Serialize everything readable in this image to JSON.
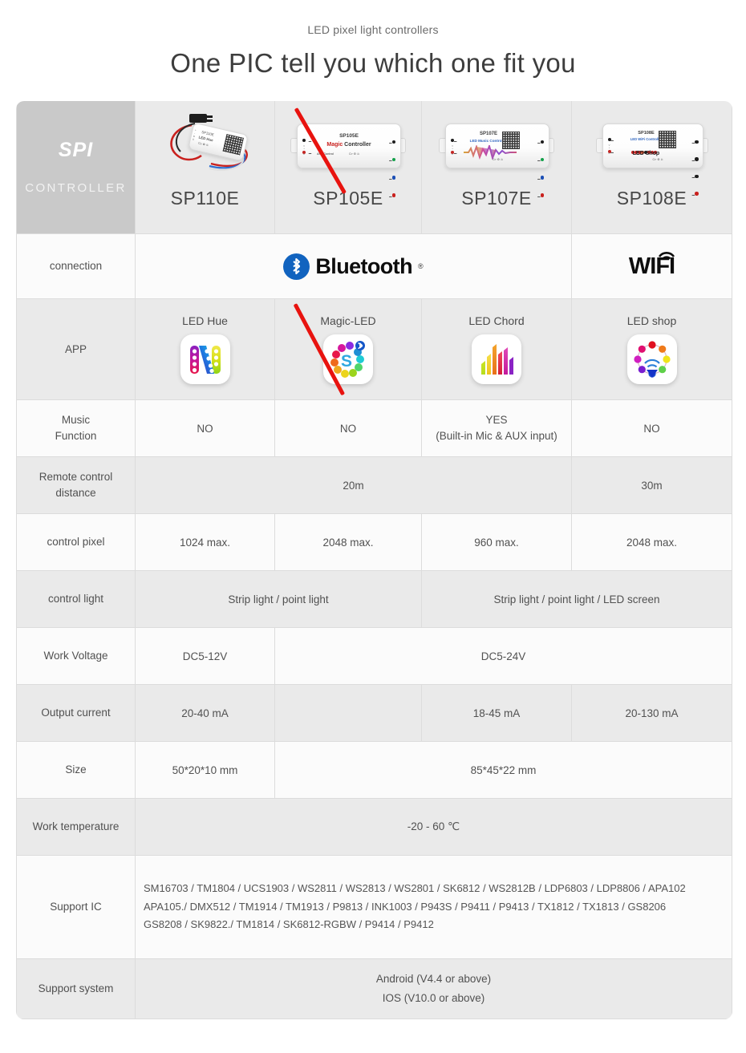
{
  "header": {
    "kicker": "LED pixel light controllers",
    "headline": "One PIC tell you which one fit you"
  },
  "table": {
    "corner": {
      "title": "SPI",
      "subtitle": "CONTROLLER"
    },
    "products": [
      {
        "name": "SP110E",
        "device_label_top": "SP110E",
        "device_label_sub": "LED Hue",
        "struck": false
      },
      {
        "name": "SP105E",
        "device_label_top": "SP105E",
        "device_label_sub": "Magic Controller",
        "device_label_small": "APP Control",
        "struck": true
      },
      {
        "name": "SP107E",
        "device_label_top": "SP107E",
        "device_label_sub": "LED Music Controller",
        "struck": false
      },
      {
        "name": "SP108E",
        "device_label_top": "SP108E",
        "device_label_sub": "LED WiFi Controller",
        "device_label_small": "LED Shop",
        "struck": false
      }
    ],
    "rows": {
      "connection": {
        "label": "connection",
        "bluetooth": "Bluetooth",
        "bluetooth_reg": "®",
        "wifi": "WIFI"
      },
      "app": {
        "label": "APP",
        "items": [
          {
            "name": "LED Hue",
            "icon": "led-hue-app-icon",
            "struck": false
          },
          {
            "name": "Magic-LED",
            "icon": "magic-led-app-icon",
            "struck": true
          },
          {
            "name": "LED Chord",
            "icon": "led-chord-app-icon",
            "struck": false
          },
          {
            "name": "LED shop",
            "icon": "led-shop-app-icon",
            "struck": false
          }
        ]
      },
      "music": {
        "label_line1": "Music",
        "label_line2": "Function",
        "values": [
          "NO",
          "NO",
          "YES",
          "NO"
        ],
        "value_3_note": "(Built-in Mic & AUX input)"
      },
      "remote": {
        "label_line1": "Remote control",
        "label_line2": "distance",
        "value_span3": "20m",
        "value_last": "30m"
      },
      "pixel": {
        "label": "control pixel",
        "values": [
          "1024 max.",
          "2048 max.",
          "960 max.",
          "2048 max."
        ]
      },
      "light": {
        "label": "control light",
        "value_left": "Strip light / point light",
        "value_right": "Strip light / point light / LED screen"
      },
      "voltage": {
        "label": "Work Voltage",
        "value_first": "DC5-12V",
        "value_rest": "DC5-24V"
      },
      "current": {
        "label": "Output current",
        "values": [
          "20-40 mA",
          "",
          "18-45 mA",
          "20-130 mA"
        ]
      },
      "size": {
        "label": "Size",
        "value_first": "50*20*10 mm",
        "value_rest": "85*45*22 mm"
      },
      "temperature": {
        "label": "Work temperature",
        "value": "-20 - 60 ℃"
      },
      "support_ic": {
        "label": "Support IC",
        "lines": [
          "SM16703 / TM1804 / UCS1903 / WS2811 / WS2813 / WS2801 / SK6812 / WS2812B / LDP6803 / LDP8806 / APA102",
          "APA105./ DMX512 / TM1914 / TM1913 / P9813 / INK1003 / P943S / P9411 / P9413 / TX1812 / TX1813 / GS8206",
          "GS8208 / SK9822./ TM1814 / SK6812-RGBW / P9414 / P9412"
        ]
      },
      "support_system": {
        "label": "Support system",
        "lines": [
          "Android (V4.4 or above)",
          "IOS (V10.0 or above)"
        ]
      }
    }
  },
  "colors": {
    "accent_red": "#e8130f",
    "bluetooth_blue": "#1163bf",
    "header_gray": "#c9c9c9",
    "row_alt": "#eaeaea",
    "row_norm": "#fbfbfb",
    "border": "#dcdcdc"
  }
}
